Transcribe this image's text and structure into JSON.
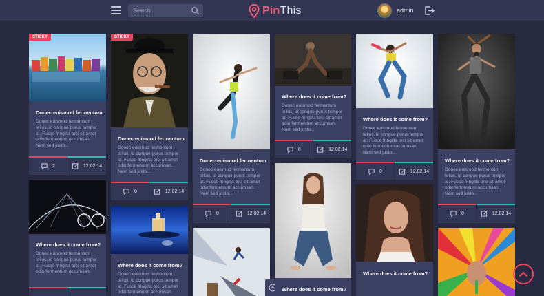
{
  "header": {
    "search_placeholder": "Search",
    "brand_part1": "Pin",
    "brand_part2": "This",
    "user_name": "admin"
  },
  "common": {
    "sticky_label": "STICKY"
  },
  "cards": [
    {
      "title": "Donec euismod fermentum",
      "body": "Donec euismod fermentum tellus, id congue purus tempor at. Fusce fringilla orci sit amet odio fermentum accumsan. Nam sed justo...",
      "comments": "2",
      "date": "12.02.14"
    },
    {
      "title": "Where does it come from?",
      "body": "Donec euismod fermentum tellus, id congue purus tempor at. Fusce fringilla orci sit amet odio fermentum accumsan."
    },
    {
      "title": "Donec euismod fermentum",
      "body": "Donec euismod fermentum tellus, id congue purus tempor at. Fusce fringilla orci sit amet odio fermentum accumsan. Nam sed justo...",
      "comments": "0",
      "date": "12.02.14"
    },
    {
      "title": "Where does it come from?",
      "body": "Donec euismod fermentum tellus, id congue purus tempor at. Fusce fringilla orci sit amet odio fermentum accumsan."
    },
    {
      "title": "Donec euismod fermentum",
      "body": "Donec euismod fermentum tellus, id congue purus tempor at. Fusce fringilla orci sit amet odio fermentum accumsan. Nam sed justo...",
      "comments": "0",
      "date": "12.02.14"
    },
    {
      "title": "Where does it come from?",
      "body": "Donec euismod fermentum tellus, id congue purus tempor at. Fusce fringilla orci sit amet odio fermentum accumsan. Nam sed justo...",
      "comments": "0",
      "date": "12.02.14"
    },
    {
      "title": "Where does it come from?"
    },
    {
      "title": "Where does it come from?",
      "body": "Donec euismod fermentum tellus, id congue purus tempor at. Fusce fringilla orci sit amet odio fermentum accumsan. Nam sed justo...",
      "comments": "0",
      "date": "12.02.14"
    },
    {
      "title": "Where does it come from?"
    },
    {
      "title": "Where does it come from?",
      "body": "Donec euismod fermentum tellus, id congue purus tempor at. Fusce fringilla orci sit amet odio fermentum accumsan. Nam sed justo...",
      "comments": "0",
      "date": "12.02.14"
    }
  ],
  "colors": {
    "accent": "#e8455d",
    "teal": "#2bbfb3",
    "card": "#3c4063",
    "bg": "#272a40"
  }
}
